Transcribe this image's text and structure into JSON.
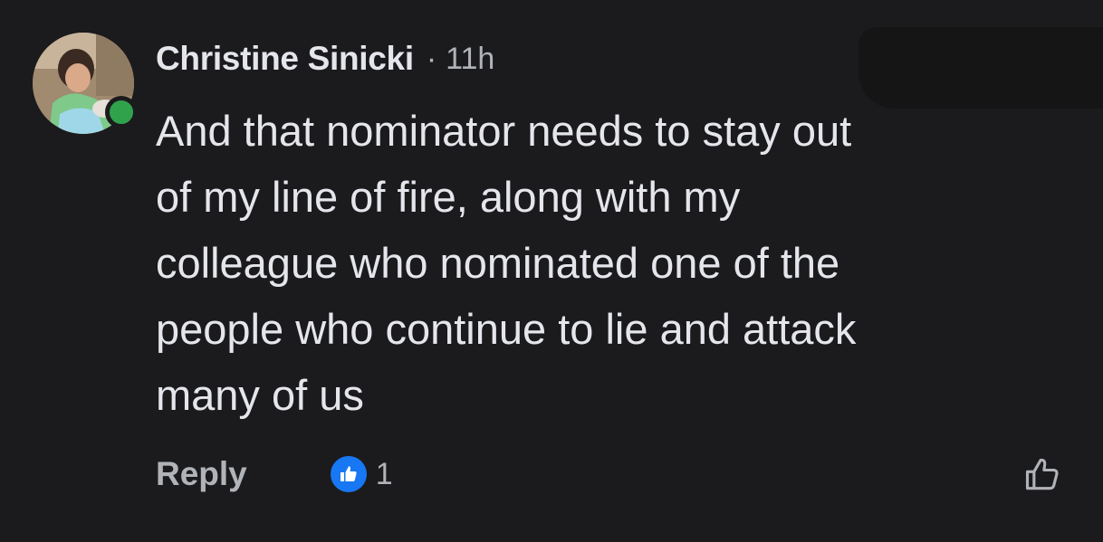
{
  "comment": {
    "author": "Christine Sinicki",
    "separator": "·",
    "time": "11h",
    "lines": [
      "And that nominator needs to stay out",
      "of my line of fire, along with my",
      "colleague who nominated one of the",
      "people who continue to lie and attack",
      "many of us"
    ],
    "online": true
  },
  "actions": {
    "reply_label": "Reply",
    "reaction_count": "1",
    "reaction_icon": "like-icon",
    "like_button_icon": "thumbs-up-outline-icon"
  },
  "colors": {
    "background": "#1b1b1d",
    "primary_text": "#e4e6eb",
    "secondary_text": "#b0b3b8",
    "like_blue": "#1877f2",
    "online_green": "#31a24c"
  }
}
